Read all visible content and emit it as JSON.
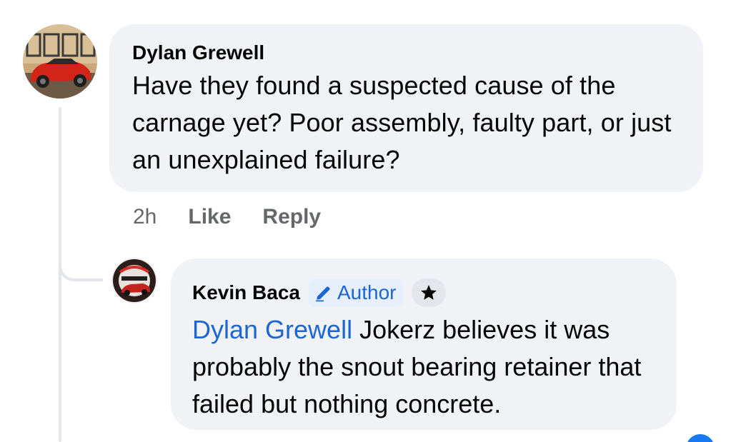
{
  "comment": {
    "author": "Dylan Grewell",
    "text": "Have they found a suspected cause of the carnage yet? Poor assembly, faulty part, or just an unexplained failure?",
    "timestamp": "2h",
    "like_label": "Like",
    "reply_label": "Reply"
  },
  "reply": {
    "author": "Kevin Baca",
    "badge_label": "Author",
    "badge_icon": "pencil-icon",
    "star_icon": "star-icon",
    "mention": "Dylan Grewell",
    "text": " Jokerz believes it was probably the snout bearing retainer that failed but nothing concrete."
  },
  "colors": {
    "bubble": "#f0f2f5",
    "link_blue": "#1b66d2",
    "meta_gray": "#65676b",
    "badge_bg": "#e7effd"
  }
}
